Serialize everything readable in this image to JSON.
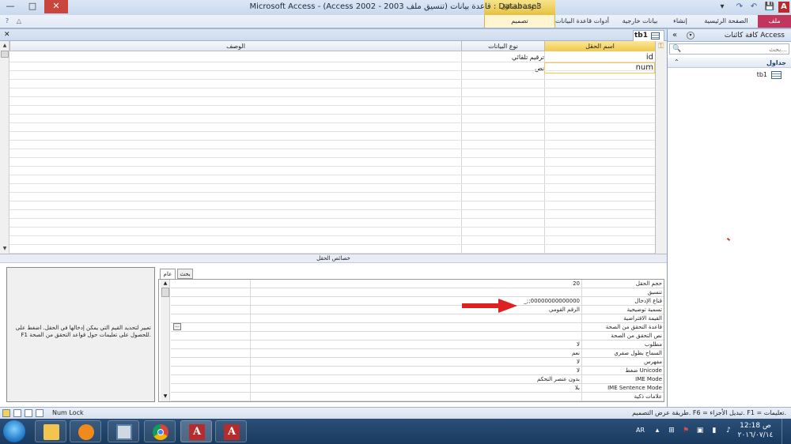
{
  "window": {
    "title": "Microsoft Access - (Access 2002 - 2003 قاعدة بيانات (تنسيق ملف : Database3",
    "context_header": "أدوات الجداول",
    "controls": {
      "minimize": "—",
      "maximize": "□",
      "close": "✕"
    },
    "qat": {
      "app": "A",
      "save": "💾",
      "undo": "↶",
      "redo": "↷",
      "customize": "▾"
    }
  },
  "ribbon": {
    "tabs": {
      "file": "ملف",
      "home": "الصفحة الرئيسية",
      "create": "إنشاء",
      "external": "بيانات خارجية",
      "dbtools": "أدوات قاعدة البيانات",
      "design": "تصميم"
    },
    "help": "?",
    "minimize": "△"
  },
  "nav_pane": {
    "title": "كافة كائنات Access",
    "collapse": "«",
    "dropdown": "▾",
    "search_placeholder": "بحث...",
    "search_icon": "🔍",
    "group_label": "جداول",
    "group_chevron": "⌃",
    "items": [
      {
        "label": "tb1",
        "icon": "table-icon"
      }
    ]
  },
  "document": {
    "tab_label": "tb1",
    "close": "✕",
    "columns": {
      "name": "اسم الحقل",
      "type": "نوع البيانات",
      "description": "الوصف"
    },
    "rows": [
      {
        "name": "id",
        "type": "ترقيم تلقائي"
      },
      {
        "name": "num",
        "type": "نص"
      }
    ],
    "scroll": {
      "up": "▲",
      "down": "▼"
    }
  },
  "field_properties": {
    "section_label": "خصائص الحقل",
    "tabs": {
      "general": "عام",
      "lookup": "بحث"
    },
    "help_text": "تعبير لتحديد القيم التي يمكن إدخالها في الحقل. اضغط على F1 للحصول على تعليمات حول قواعد التحقق من الصحة.",
    "ellipsis": "...",
    "rows": [
      {
        "label": "حجم الحقل",
        "value": "20"
      },
      {
        "label": "تنسيق",
        "value": ""
      },
      {
        "label": "قناع الإدخال",
        "value": "_;;00000000000000"
      },
      {
        "label": "تسمية توضيحية",
        "value": "الرقم القومي"
      },
      {
        "label": "القيمة الافتراضية",
        "value": ""
      },
      {
        "label": "قاعدة التحقق من الصحة",
        "value": ""
      },
      {
        "label": "نص التحقق من الصحة",
        "value": ""
      },
      {
        "label": "مطلوب",
        "value": "لا"
      },
      {
        "label": "السماح بطول صفري",
        "value": "نعم"
      },
      {
        "label": "مفهرس",
        "value": "لا"
      },
      {
        "label": "ضغط Unicode",
        "value": "لا"
      },
      {
        "label": "IME Mode",
        "value": "بدون عنصر التحكم"
      },
      {
        "label": "IME Sentence Mode",
        "value": "بلا"
      },
      {
        "label": "علامات ذكية",
        "value": ""
      }
    ]
  },
  "status_bar": {
    "text": "طريقة عرض التصميم. F6 = تبديل الأجزاء. F1 = تعليمات.",
    "numlock": "Num Lock"
  },
  "taskbar": {
    "lang": "AR",
    "time": "12:18 ص",
    "date": "٢٠١٦/٠٧/١٤",
    "tray": {
      "flag": "⚑",
      "volume": "♪",
      "network": "▮"
    }
  },
  "colors": {
    "accent_file_tab": "#c2355c",
    "context_tools": "#e6c240",
    "arrow": "#e02020"
  }
}
